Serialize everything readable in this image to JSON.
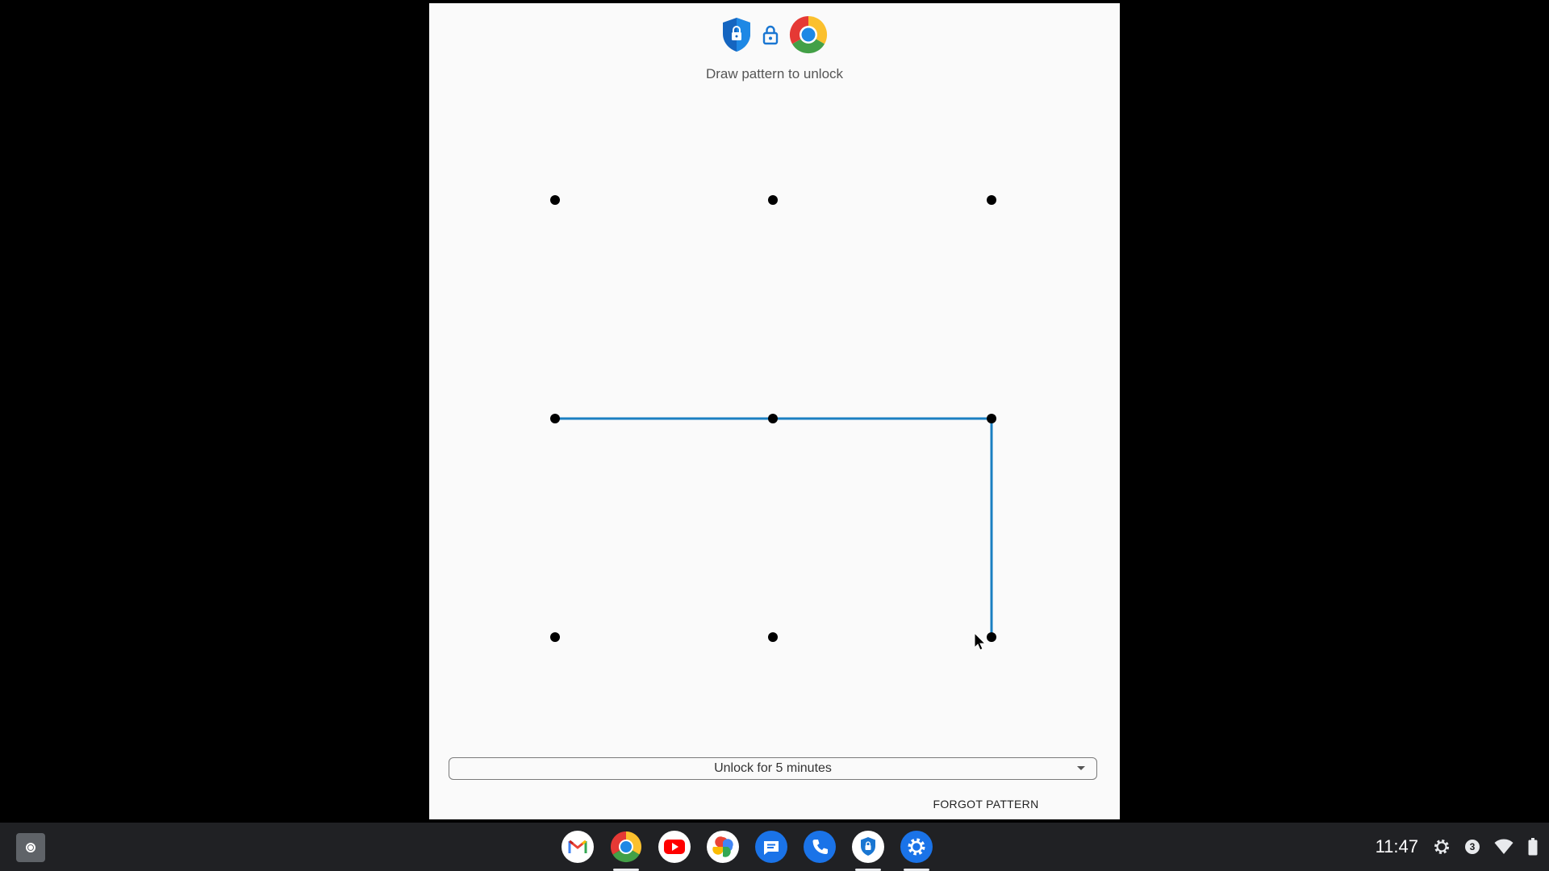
{
  "app": {
    "prompt_text": "Draw pattern to unlock",
    "header_icons": [
      "shield-lock-icon",
      "padlock-icon",
      "chrome-icon"
    ],
    "unlock_duration": {
      "selected": "Unlock for 5 minutes"
    },
    "forgot_label": "FORGOT PATTERN",
    "pattern": {
      "grid": "3x3",
      "connected_path": [
        "row2-col1",
        "row2-col2",
        "row2-col3",
        "row3-col3"
      ],
      "line_color": "#1a7fc1",
      "dot_color": "#000000"
    }
  },
  "shelf": {
    "apps": [
      {
        "name": "gmail-icon",
        "running": false
      },
      {
        "name": "chrome-icon",
        "running": true
      },
      {
        "name": "youtube-icon",
        "running": false
      },
      {
        "name": "google-photos-icon",
        "running": false
      },
      {
        "name": "messages-icon",
        "running": false
      },
      {
        "name": "phone-icon",
        "running": false
      },
      {
        "name": "app-lock-icon",
        "running": true
      },
      {
        "name": "settings-icon",
        "running": true
      }
    ],
    "status": {
      "time": "11:47",
      "notification_count": "3",
      "icons": [
        "settings-gear-icon",
        "wifi-icon",
        "battery-icon"
      ]
    }
  }
}
